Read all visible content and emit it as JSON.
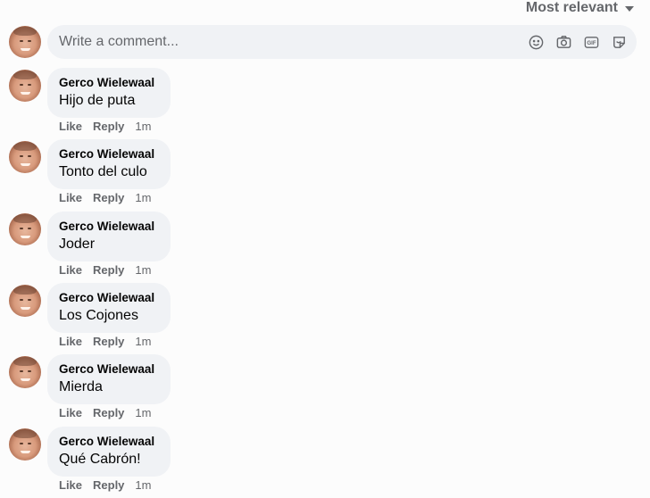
{
  "sort": {
    "label": "Most relevant",
    "icon": "caret-down-icon"
  },
  "composer": {
    "placeholder": "Write a comment...",
    "icons": [
      "emoji-icon",
      "camera-icon",
      "gif-icon",
      "sticker-icon"
    ]
  },
  "actions": {
    "like": "Like",
    "reply": "Reply"
  },
  "comments": [
    {
      "author": "Gerco Wielewaal",
      "text": "Hijo de puta",
      "time": "1m"
    },
    {
      "author": "Gerco Wielewaal",
      "text": "Tonto del culo",
      "time": "1m"
    },
    {
      "author": "Gerco Wielewaal",
      "text": "Joder",
      "time": "1m"
    },
    {
      "author": "Gerco Wielewaal",
      "text": "Los Cojones",
      "time": "1m"
    },
    {
      "author": "Gerco Wielewaal",
      "text": "Mierda",
      "time": "1m"
    },
    {
      "author": "Gerco Wielewaal",
      "text": "Qué Cabrón!",
      "time": "1m"
    }
  ],
  "colors": {
    "bubble": "#f0f2f5",
    "secondary_text": "#65676b",
    "primary_text": "#050505"
  }
}
